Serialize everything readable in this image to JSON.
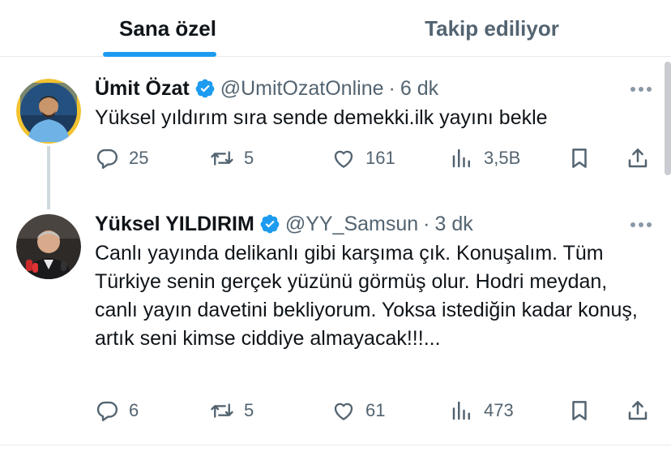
{
  "tabs": [
    {
      "label": "Sana özel",
      "active": true
    },
    {
      "label": "Takip ediliyor",
      "active": false
    }
  ],
  "colors": {
    "accent": "#1d9bf0",
    "muted": "#536471",
    "text": "#0f1419"
  },
  "tweets": [
    {
      "name": "Ümit Özat",
      "handle": "@UmitOzatOnline",
      "separator": "·",
      "time": "6 dk",
      "text": "Yüksel yıldırım sıra sende demekki.ilk yayını bekle",
      "replies": "25",
      "retweets": "5",
      "likes": "161",
      "views": "3,5B"
    },
    {
      "name": "Yüksel YILDIRIM",
      "handle": "@YY_Samsun",
      "separator": "·",
      "time": "3 dk",
      "text": "Canlı yayında delikanlı gibi karşıma çık. Konuşalım. Tüm Türkiye senin gerçek yüzünü görmüş olur. Hodri meydan, canlı yayın davetini bekliyorum. Yoksa istediğin kadar konuş, artık seni kimse ciddiye almayacak!!!...",
      "replies": "6",
      "retweets": "5",
      "likes": "61",
      "views": "473"
    }
  ],
  "icons": [
    "verified-badge-icon",
    "more-icon",
    "reply-icon",
    "retweet-icon",
    "like-icon",
    "views-icon",
    "bookmark-icon",
    "share-icon"
  ]
}
